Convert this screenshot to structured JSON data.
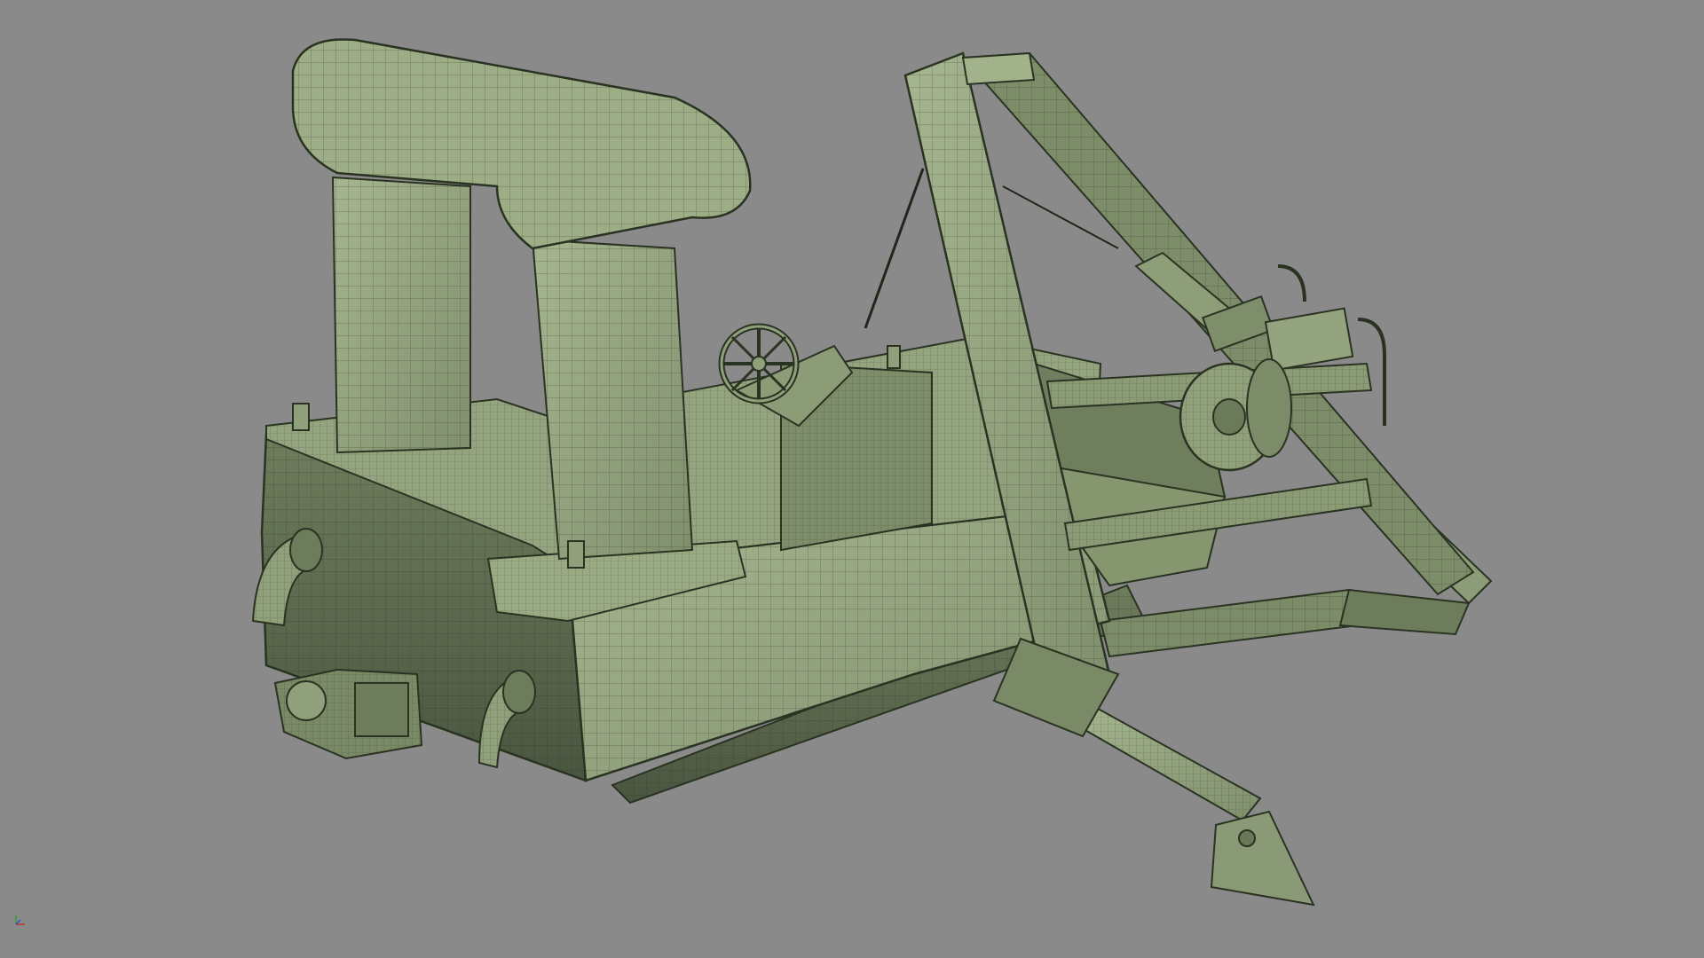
{
  "viewport": {
    "background": "#8a8a8a",
    "render_mode": "wireframe-on-shaded",
    "model_color": "#8fa07a",
    "model_dark": "#4f5c42",
    "wire_color": "#2a3322"
  },
  "scene": {
    "object": "boat-with-launch-frame",
    "parts": [
      "hull",
      "cabin-canopy",
      "steering-wheel",
      "console",
      "a-frame",
      "winch-drum",
      "tow-bar",
      "outboard-jets",
      "engine"
    ]
  },
  "axis_gizmo": {
    "axes": [
      "x",
      "y",
      "z"
    ],
    "colors": {
      "x": "#c83030",
      "y": "#30a030",
      "z": "#3050c8"
    }
  }
}
